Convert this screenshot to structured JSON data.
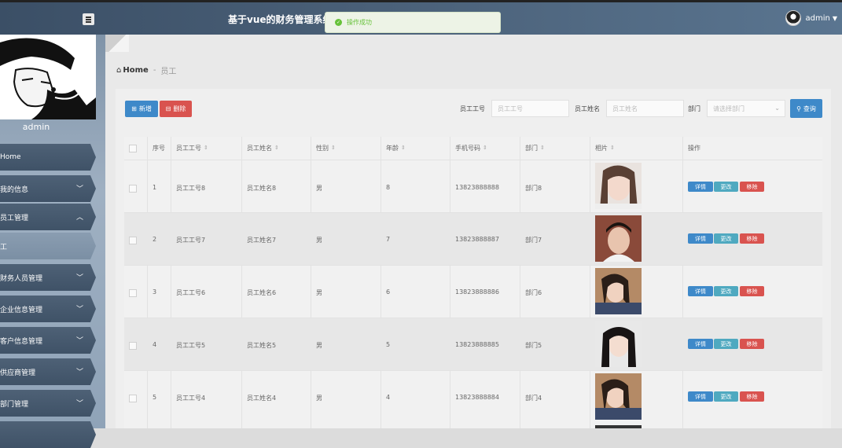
{
  "header": {
    "title": "基于vue的财务管理系统",
    "user": "admin"
  },
  "toast": {
    "message": "操作成功"
  },
  "sidebar": {
    "username": "admin",
    "items": [
      {
        "label": "Home",
        "chevron": ""
      },
      {
        "label": "我的信息",
        "chevron": "v"
      },
      {
        "label": "员工管理",
        "chevron": "^"
      },
      {
        "label": "工",
        "chevron": ""
      },
      {
        "label": "财务人员管理",
        "chevron": "v"
      },
      {
        "label": "企业信息管理",
        "chevron": "v"
      },
      {
        "label": "客户信息管理",
        "chevron": "v"
      },
      {
        "label": "供应商管理",
        "chevron": "v"
      },
      {
        "label": "部门管理",
        "chevron": "v"
      }
    ]
  },
  "breadcrumb": {
    "home": "Home",
    "sep": "-",
    "current": "员工"
  },
  "toolbar": {
    "add": "新增",
    "delete": "删除",
    "search": "查询"
  },
  "filters": {
    "emp_no_label": "员工工号",
    "emp_no_placeholder": "员工工号",
    "emp_name_label": "员工姓名",
    "emp_name_placeholder": "员工姓名",
    "dept_label": "部门",
    "dept_placeholder": "请选择部门"
  },
  "table": {
    "headers": [
      "序号",
      "员工工号",
      "员工姓名",
      "性别",
      "年龄",
      "手机号码",
      "部门",
      "相片",
      "操作"
    ],
    "rows": [
      {
        "idx": "1",
        "no": "员工工号8",
        "name": "员工姓名8",
        "gender": "男",
        "age": "8",
        "phone": "13823888888",
        "dept": "部门8"
      },
      {
        "idx": "2",
        "no": "员工工号7",
        "name": "员工姓名7",
        "gender": "男",
        "age": "7",
        "phone": "13823888887",
        "dept": "部门7"
      },
      {
        "idx": "3",
        "no": "员工工号6",
        "name": "员工姓名6",
        "gender": "男",
        "age": "6",
        "phone": "13823888886",
        "dept": "部门6"
      },
      {
        "idx": "4",
        "no": "员工工号5",
        "name": "员工姓名5",
        "gender": "男",
        "age": "5",
        "phone": "13823888885",
        "dept": "部门5"
      },
      {
        "idx": "5",
        "no": "员工工号4",
        "name": "员工姓名4",
        "gender": "男",
        "age": "4",
        "phone": "13823888884",
        "dept": "部门4"
      }
    ],
    "actions": {
      "detail": "详情",
      "edit": "更改",
      "remove": "移除"
    }
  }
}
